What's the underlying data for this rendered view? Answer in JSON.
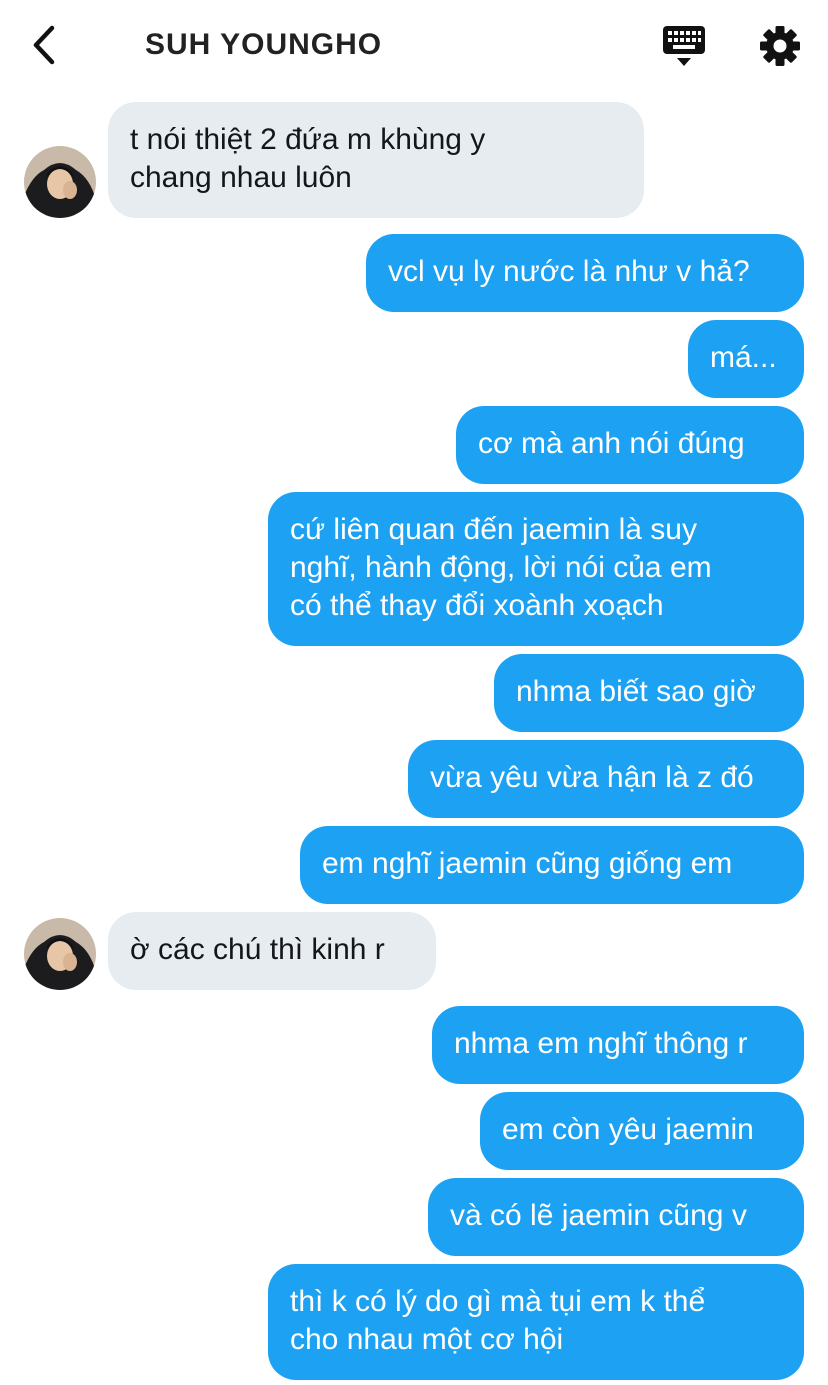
{
  "header": {
    "title": "SUH YOUNGHO",
    "back_icon": "chevron-left-icon",
    "keyboard_icon": "keyboard-icon",
    "settings_icon": "gear-icon"
  },
  "colors": {
    "outgoing": "#1da1f2",
    "incoming": "#e7ecf0"
  },
  "messages": [
    {
      "dir": "in",
      "lines": [
        "t nói thiệt 2 đứa m khùng y",
        "chang nhau luôn"
      ]
    },
    {
      "dir": "out",
      "lines": [
        "vcl vụ ly nước là như v hả?"
      ]
    },
    {
      "dir": "out",
      "lines": [
        "má..."
      ]
    },
    {
      "dir": "out",
      "lines": [
        "cơ mà anh nói đúng"
      ]
    },
    {
      "dir": "out",
      "lines": [
        "cứ liên quan đến jaemin là suy",
        "nghĩ, hành động, lời nói của em",
        "có thể thay đổi xoành xoạch"
      ]
    },
    {
      "dir": "out",
      "lines": [
        "nhma biết sao giờ"
      ]
    },
    {
      "dir": "out",
      "lines": [
        "vừa yêu vừa hận là z đó"
      ]
    },
    {
      "dir": "out",
      "lines": [
        "em nghĩ jaemin cũng giống em"
      ]
    },
    {
      "dir": "in",
      "lines": [
        "ờ các chú thì kinh r"
      ]
    },
    {
      "dir": "out",
      "lines": [
        "nhma em nghĩ thông r"
      ]
    },
    {
      "dir": "out",
      "lines": [
        "em còn yêu jaemin"
      ]
    },
    {
      "dir": "out",
      "lines": [
        "và có lẽ jaemin cũng v"
      ]
    },
    {
      "dir": "out",
      "lines": [
        "thì k có lý do gì mà tụi em k thể",
        "cho nhau một cơ hội"
      ]
    }
  ]
}
